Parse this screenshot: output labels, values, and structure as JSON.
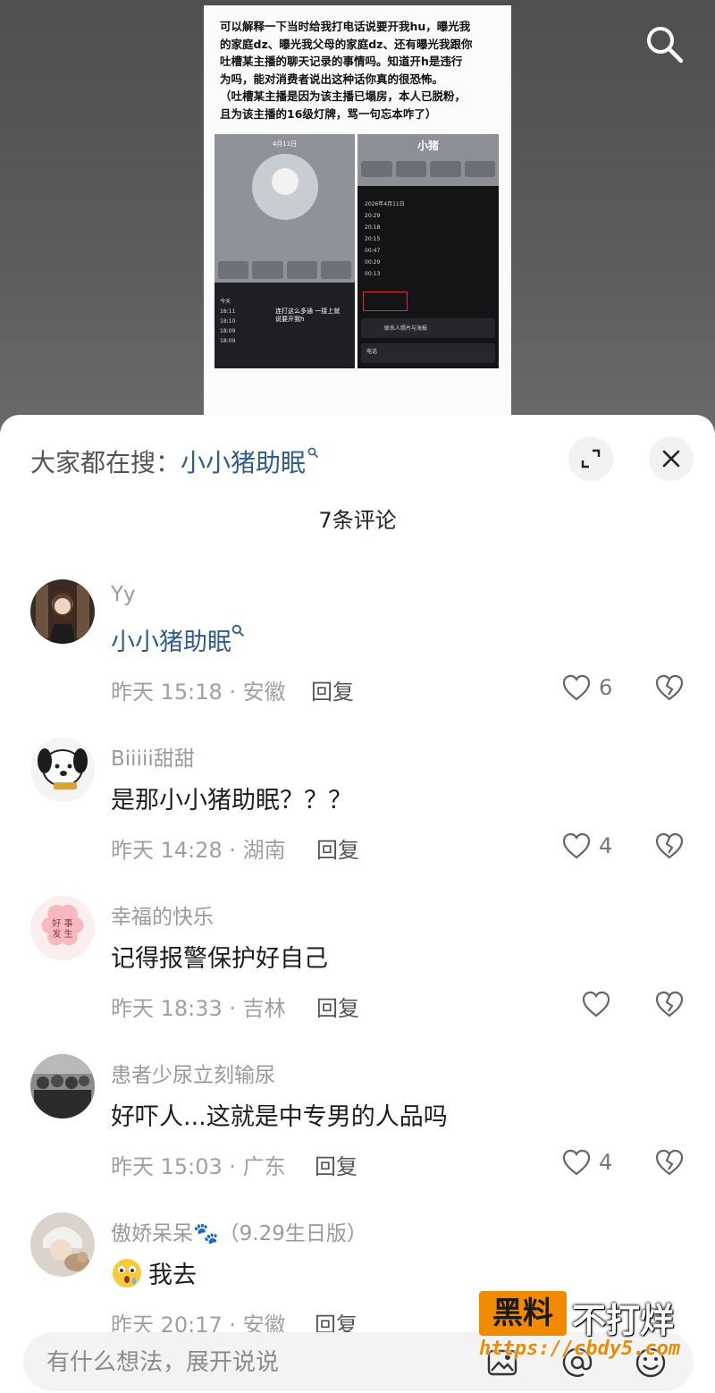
{
  "post": {
    "text_lines": [
      "可以解释一下当时给我打电话说要开我hu，曝光我",
      "的家庭dz、曝光我父母的家庭dz、还有曝光我跟你",
      "吐槽某主播的聊天记录的事情吗。知道开h是违行",
      "为吗，能对消费者说出这种话你真的很恐怖。",
      "（吐槽某主播是因为该主播已塌房，本人已脱粉，",
      "且为该主播的16级灯牌，骂一句忘本咋了）"
    ],
    "screenshot_left": {
      "date": "4月11日",
      "note": "连打这么多通 一接上就说要开我h"
    },
    "screenshot_right": {
      "title": "小猪",
      "log_header": "2026年4月11日",
      "contact_row": "联系人照片与海报",
      "bottom_row": "电话"
    }
  },
  "hot_search": {
    "label": "大家都在搜：",
    "term": "小小猪助眠"
  },
  "comments_title": "7条评论",
  "comments": [
    {
      "name": "Yy",
      "content": "小小猪助眠",
      "meta": "昨天 15:18 · 安徽",
      "reply": "回复",
      "likes": "6"
    },
    {
      "name": "Biiiii甜甜",
      "content": "是那小小猪助眠？？？",
      "meta": "昨天 14:28 · 湖南",
      "reply": "回复",
      "likes": "4"
    },
    {
      "name": "幸福的快乐",
      "content": "记得报警保护好自己",
      "meta": "昨天 18:33 · 吉林",
      "reply": "回复",
      "likes": ""
    },
    {
      "name": "患者少尿立刻输尿",
      "content": "好吓人...这就是中专男的人品吗",
      "meta": "昨天 15:03 · 广东",
      "reply": "回复",
      "likes": "4"
    },
    {
      "name": "傲娇呆呆🐾（9.29生日版）",
      "content": "我去",
      "meta": "昨天 20:17 · 安徽",
      "reply": "回复",
      "likes": ""
    }
  ],
  "input": {
    "placeholder": "有什么想法，展开说说"
  },
  "watermark": {
    "badge": "黑料",
    "text": "不打烊",
    "url": "https://cbdy5.com"
  },
  "icons": [
    "search-icon",
    "expand-icon",
    "close-icon",
    "heart-icon",
    "broken-heart-icon",
    "image-icon",
    "at-icon",
    "emoji-icon"
  ],
  "colors": {
    "link": "#2f5d8f",
    "accent": "#f08a00"
  }
}
